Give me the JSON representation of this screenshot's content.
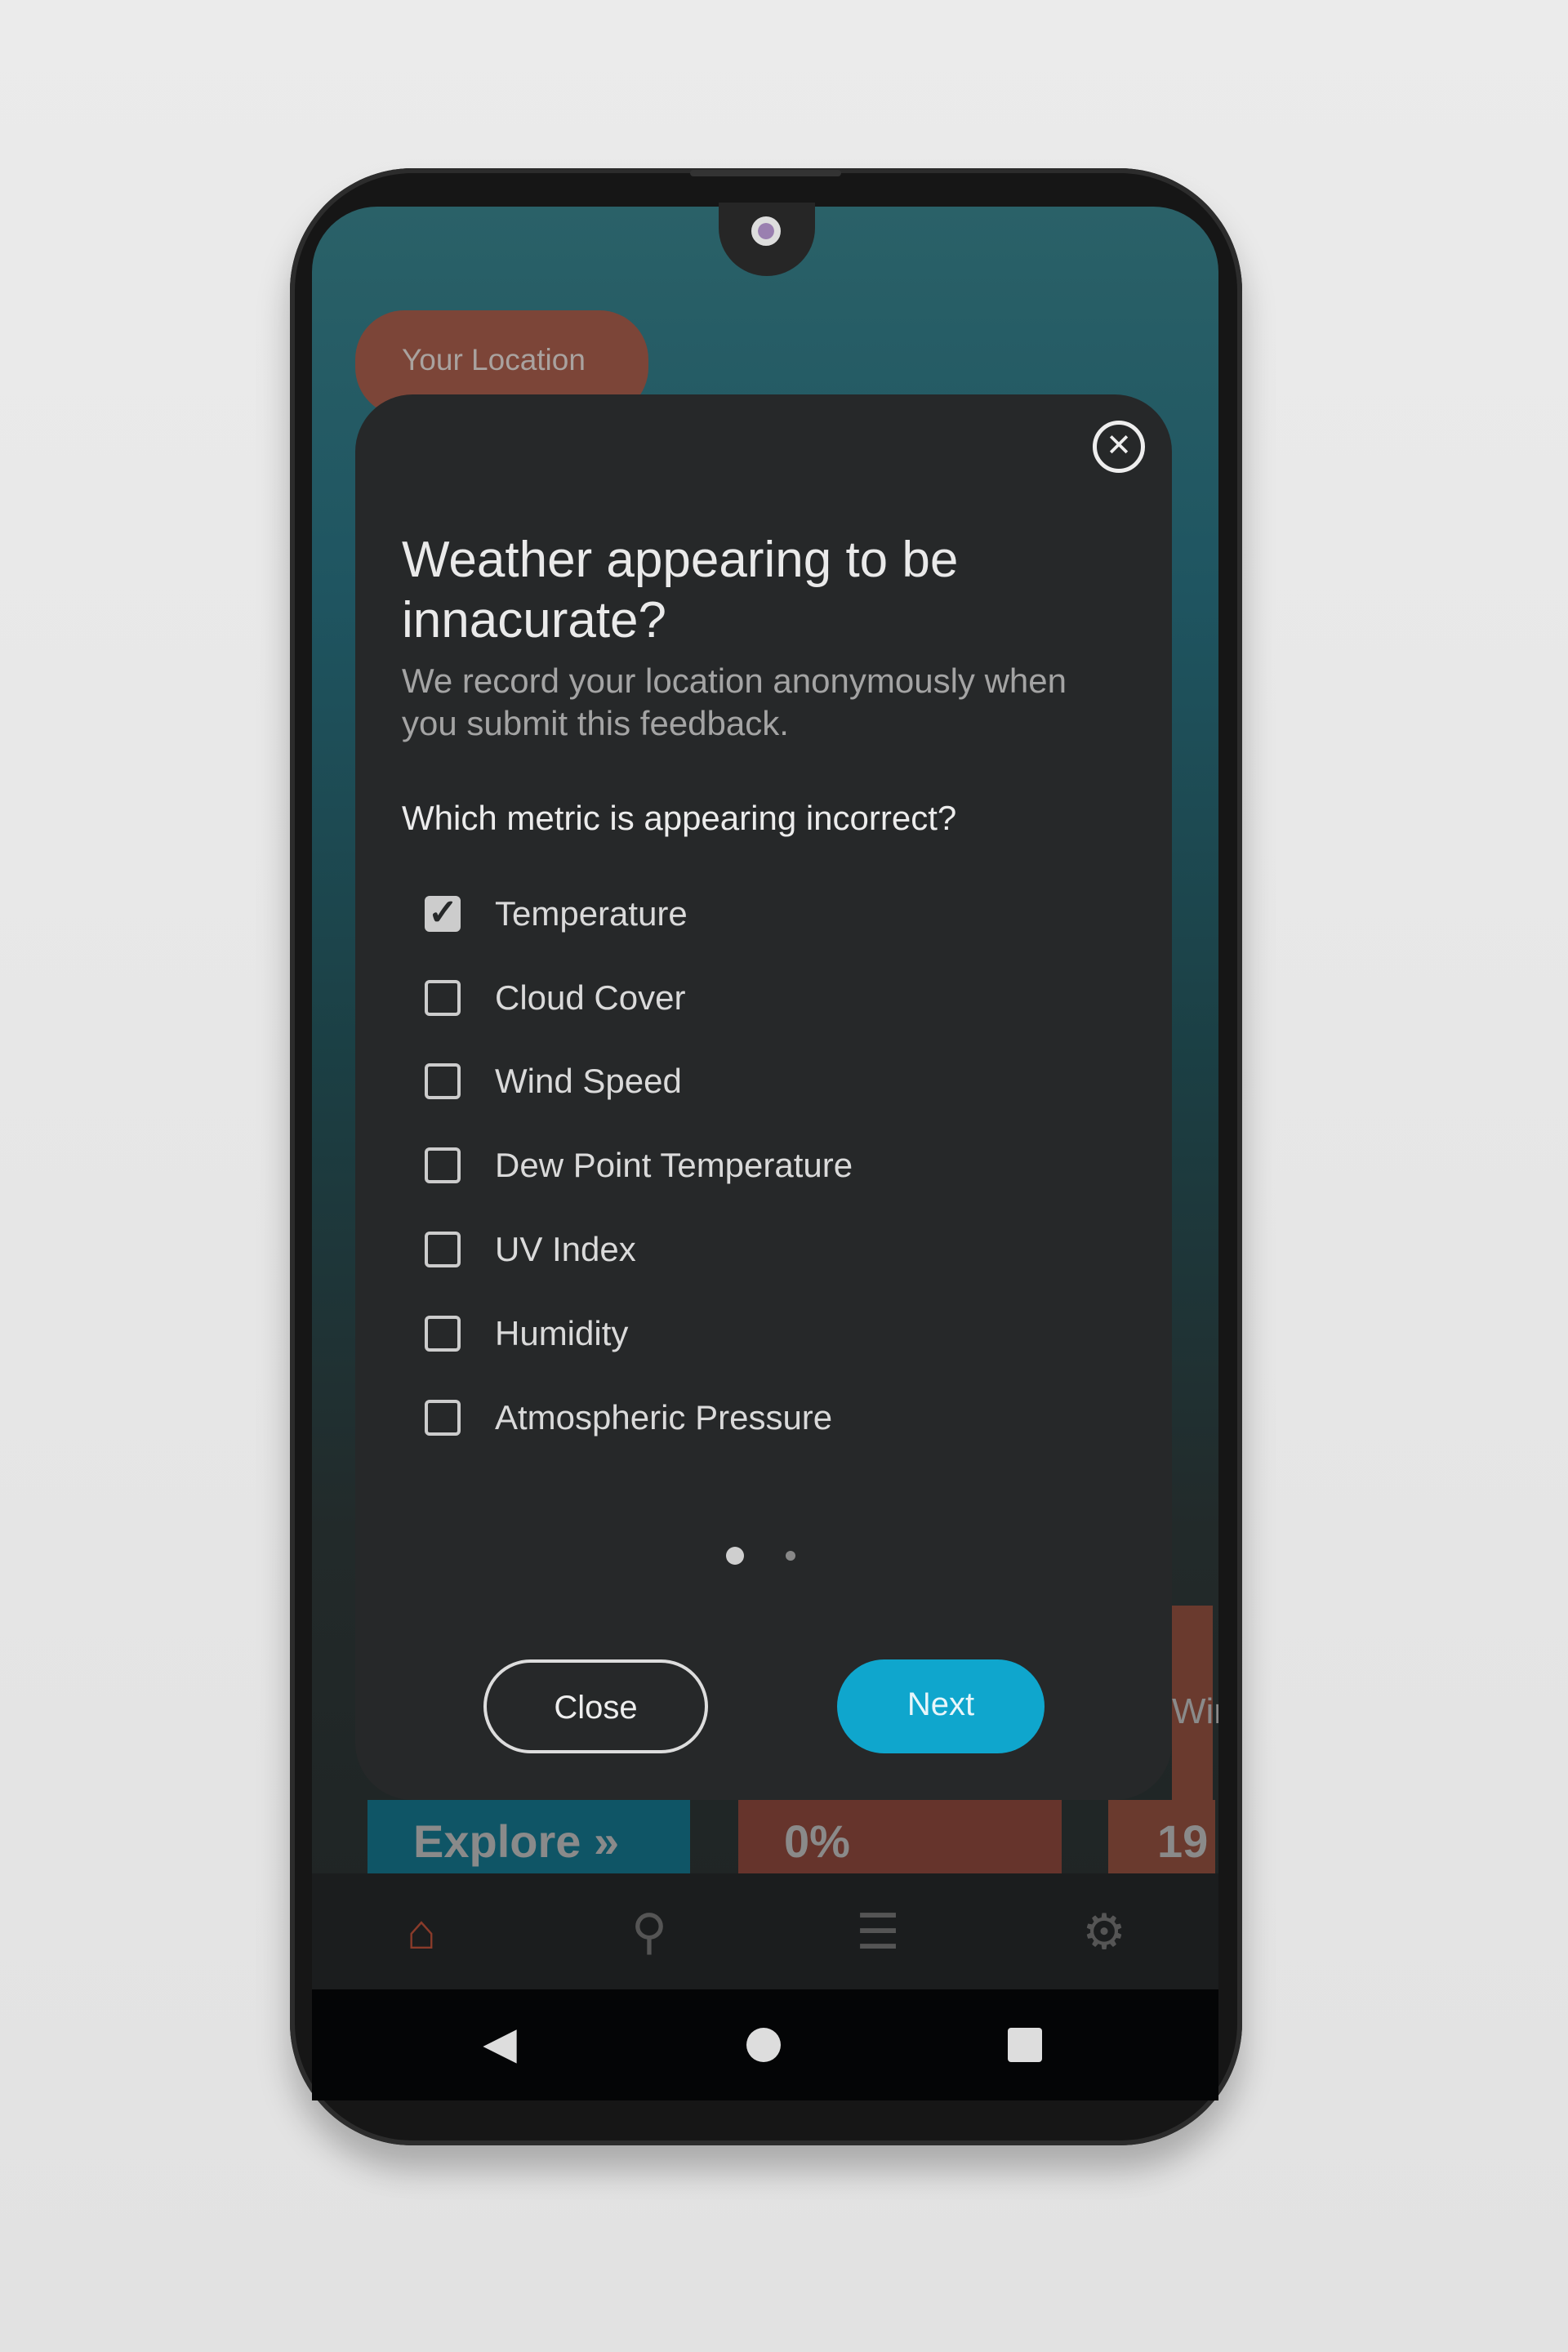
{
  "app": {
    "location_chip": "Your Location"
  },
  "dialog": {
    "title_line1": "Weather appearing to be",
    "title_line2": "innacurate?",
    "subtitle": "We record your location anonymously when you submit this feedback.",
    "question": "Which metric is appearing incorrect?",
    "options": [
      {
        "label": "Temperature",
        "checked": true
      },
      {
        "label": "Cloud Cover",
        "checked": false
      },
      {
        "label": "Wind Speed",
        "checked": false
      },
      {
        "label": "Dew Point Temperature",
        "checked": false
      },
      {
        "label": "UV Index",
        "checked": false
      },
      {
        "label": "Humidity",
        "checked": false
      },
      {
        "label": "Atmospheric Pressure",
        "checked": false
      }
    ],
    "page_indicator": {
      "current": 1,
      "total": 2
    },
    "close_label": "Close",
    "next_label": "Next"
  },
  "cards": [
    {
      "label": "Explore »",
      "color": "#0f5566"
    },
    {
      "label": "0%",
      "color": "#66342c"
    },
    {
      "label": "19",
      "color": "#6a3a2e"
    }
  ],
  "side_card_text": "Win",
  "bottom_nav": [
    {
      "icon": "home-icon",
      "active": true
    },
    {
      "icon": "search-icon"
    },
    {
      "icon": "list-icon"
    },
    {
      "icon": "gear-icon"
    }
  ],
  "colors": {
    "accent": "#0fa6cd",
    "brand": "#8a3b2a",
    "dialog_bg": "#262829"
  }
}
